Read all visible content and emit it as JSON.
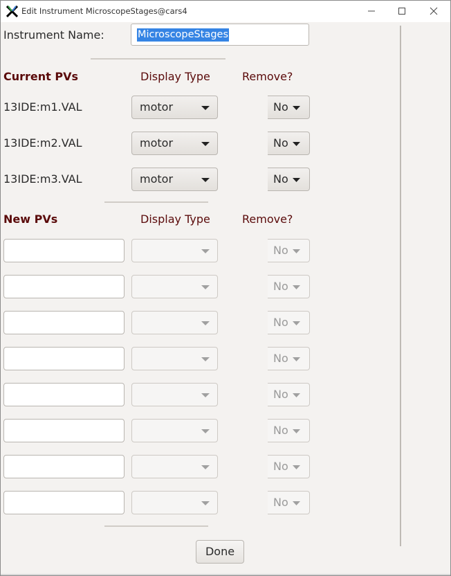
{
  "window": {
    "title": "Edit Instrument  MicroscopeStages@cars4",
    "app_icon": "x-logo-icon",
    "controls": [
      "minimize-icon",
      "maximize-icon",
      "close-icon"
    ]
  },
  "instrument": {
    "label": "Instrument Name:",
    "value": "MicroscopeStages"
  },
  "current": {
    "header": "Current PVs",
    "display_type_header": "Display Type",
    "remove_header": "Remove?",
    "rows": [
      {
        "pv": "13IDE:m1.VAL",
        "display_type": "motor",
        "remove": "No"
      },
      {
        "pv": "13IDE:m2.VAL",
        "display_type": "motor",
        "remove": "No"
      },
      {
        "pv": "13IDE:m3.VAL",
        "display_type": "motor",
        "remove": "No"
      }
    ]
  },
  "new": {
    "header": "New PVs",
    "display_type_header": "Display Type",
    "remove_header": "Remove?",
    "rows": [
      {
        "pv": "",
        "display_type": "",
        "remove": "No"
      },
      {
        "pv": "",
        "display_type": "",
        "remove": "No"
      },
      {
        "pv": "",
        "display_type": "",
        "remove": "No"
      },
      {
        "pv": "",
        "display_type": "",
        "remove": "No"
      },
      {
        "pv": "",
        "display_type": "",
        "remove": "No"
      },
      {
        "pv": "",
        "display_type": "",
        "remove": "No"
      },
      {
        "pv": "",
        "display_type": "",
        "remove": "No"
      },
      {
        "pv": "",
        "display_type": "",
        "remove": "No"
      }
    ]
  },
  "done_label": "Done",
  "colors": {
    "header_text": "#5a0a0a",
    "selection": "#3584e4",
    "panel_bg": "#f4f2f0"
  }
}
